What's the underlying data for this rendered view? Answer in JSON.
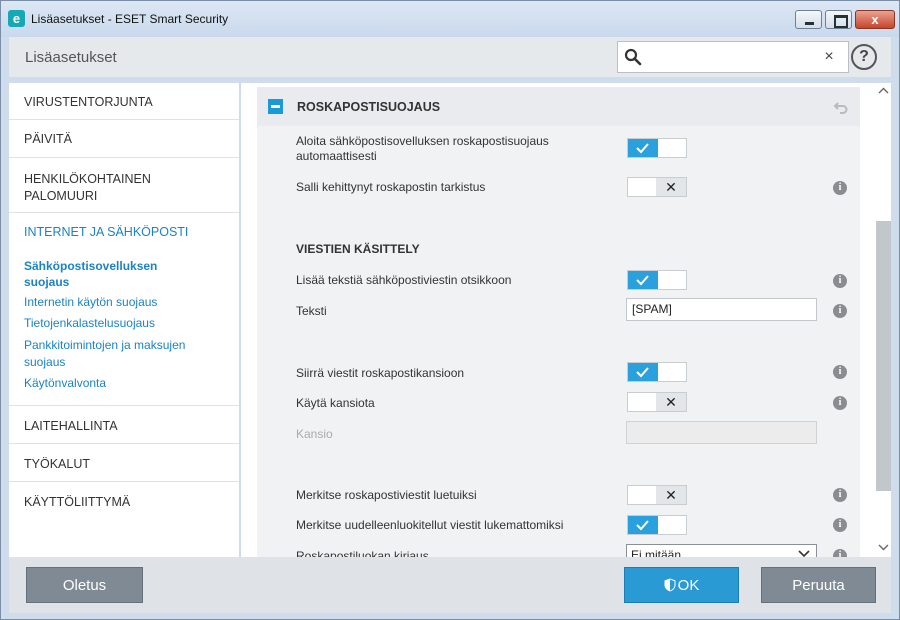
{
  "window": {
    "title": "Lisäasetukset - ESET Smart Security",
    "logo_letter": "e",
    "close_glyph": "x"
  },
  "header": {
    "title": "Lisäasetukset",
    "search_value": "",
    "clear_glyph": "×",
    "help_glyph": "?"
  },
  "sidebar": {
    "items": [
      {
        "label": "VIRUSTENTORJUNTA"
      },
      {
        "label": "PÄIVITÄ"
      },
      {
        "label": "HENKILÖKOHTAINEN PALOMUURI"
      },
      {
        "label": "INTERNET JA SÄHKÖPOSTI"
      },
      {
        "label": "LAITEHALLINTA"
      },
      {
        "label": "TYÖKALUT"
      },
      {
        "label": "KÄYTTÖLIITTYMÄ"
      }
    ],
    "subitems": [
      {
        "label": "Sähköpostisovelluksen suojaus",
        "active": true
      },
      {
        "label": "Internetin käytön suojaus"
      },
      {
        "label": "Tietojenkalastelusuojaus"
      },
      {
        "label": "Pankkitoimintojen ja maksujen suojaus"
      },
      {
        "label": "Käytönvalvonta"
      }
    ]
  },
  "main": {
    "section_title": "ROSKAPOSTISUOJAUS",
    "group_title": "VIESTIEN KÄSITTELY",
    "rows": {
      "auto_start": {
        "label": "Aloita sähköpostisovelluksen roskapostisuojaus automaattisesti",
        "value": true
      },
      "advanced_check": {
        "label": "Salli kehittynyt roskapostin tarkistus",
        "value": false
      },
      "add_text": {
        "label": "Lisää tekstiä sähköpostiviestin otsikkoon",
        "value": true
      },
      "text": {
        "label": "Teksti",
        "value": "[SPAM]"
      },
      "move_to_folder": {
        "label": "Siirrä viestit roskapostikansioon",
        "value": true
      },
      "use_folder": {
        "label": "Käytä kansiota",
        "value": false
      },
      "folder": {
        "label": "Kansio",
        "value": ""
      },
      "mark_read": {
        "label": "Merkitse roskapostiviestit luetuiksi",
        "value": false
      },
      "mark_unread": {
        "label": "Merkitse uudelleenluokitellut viestit lukemattomiksi",
        "value": true
      },
      "log_level": {
        "label": "Roskapostiluokan kirjaus",
        "value": "Ei mitään"
      }
    },
    "off_glyph": "✕",
    "info_glyph": "i"
  },
  "footer": {
    "default_label": "Oletus",
    "ok_label": "OK",
    "cancel_label": "Peruuta"
  },
  "colors": {
    "accent": "#2aa0dc",
    "link": "#1a83c7",
    "button_gray": "#7f8a94"
  }
}
